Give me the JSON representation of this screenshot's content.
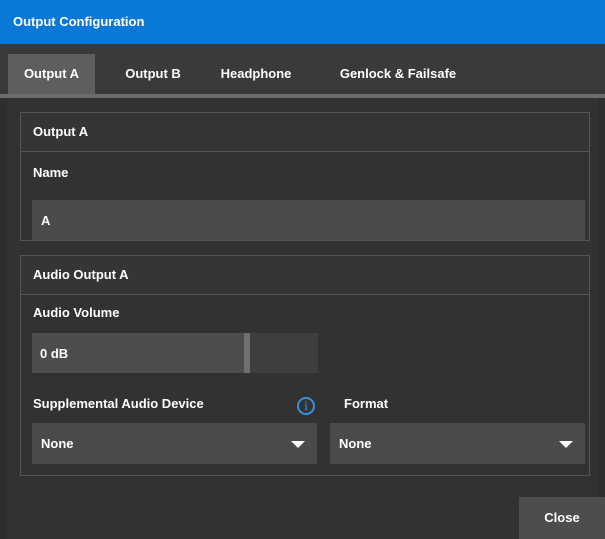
{
  "window": {
    "title": "Output Configuration"
  },
  "tabs": [
    {
      "label": "Output A",
      "active": true
    },
    {
      "label": "Output B",
      "active": false
    },
    {
      "label": "Headphone",
      "active": false
    },
    {
      "label": "Genlock & Failsafe",
      "active": false
    }
  ],
  "output_group": {
    "title": "Output A",
    "name_label": "Name",
    "name_value": "A"
  },
  "audio_group": {
    "title": "Audio Output A",
    "volume_label": "Audio Volume",
    "volume_value": "0 dB",
    "volume_level_fraction": 0.74,
    "supplemental_label": "Supplemental Audio Device",
    "supplemental_value": "None",
    "info_icon": "info-icon",
    "format_label": "Format",
    "format_value": "None"
  },
  "footer": {
    "close_label": "Close"
  },
  "colors": {
    "titlebar": "#0a78d7",
    "info_icon": "#3a8fde"
  }
}
